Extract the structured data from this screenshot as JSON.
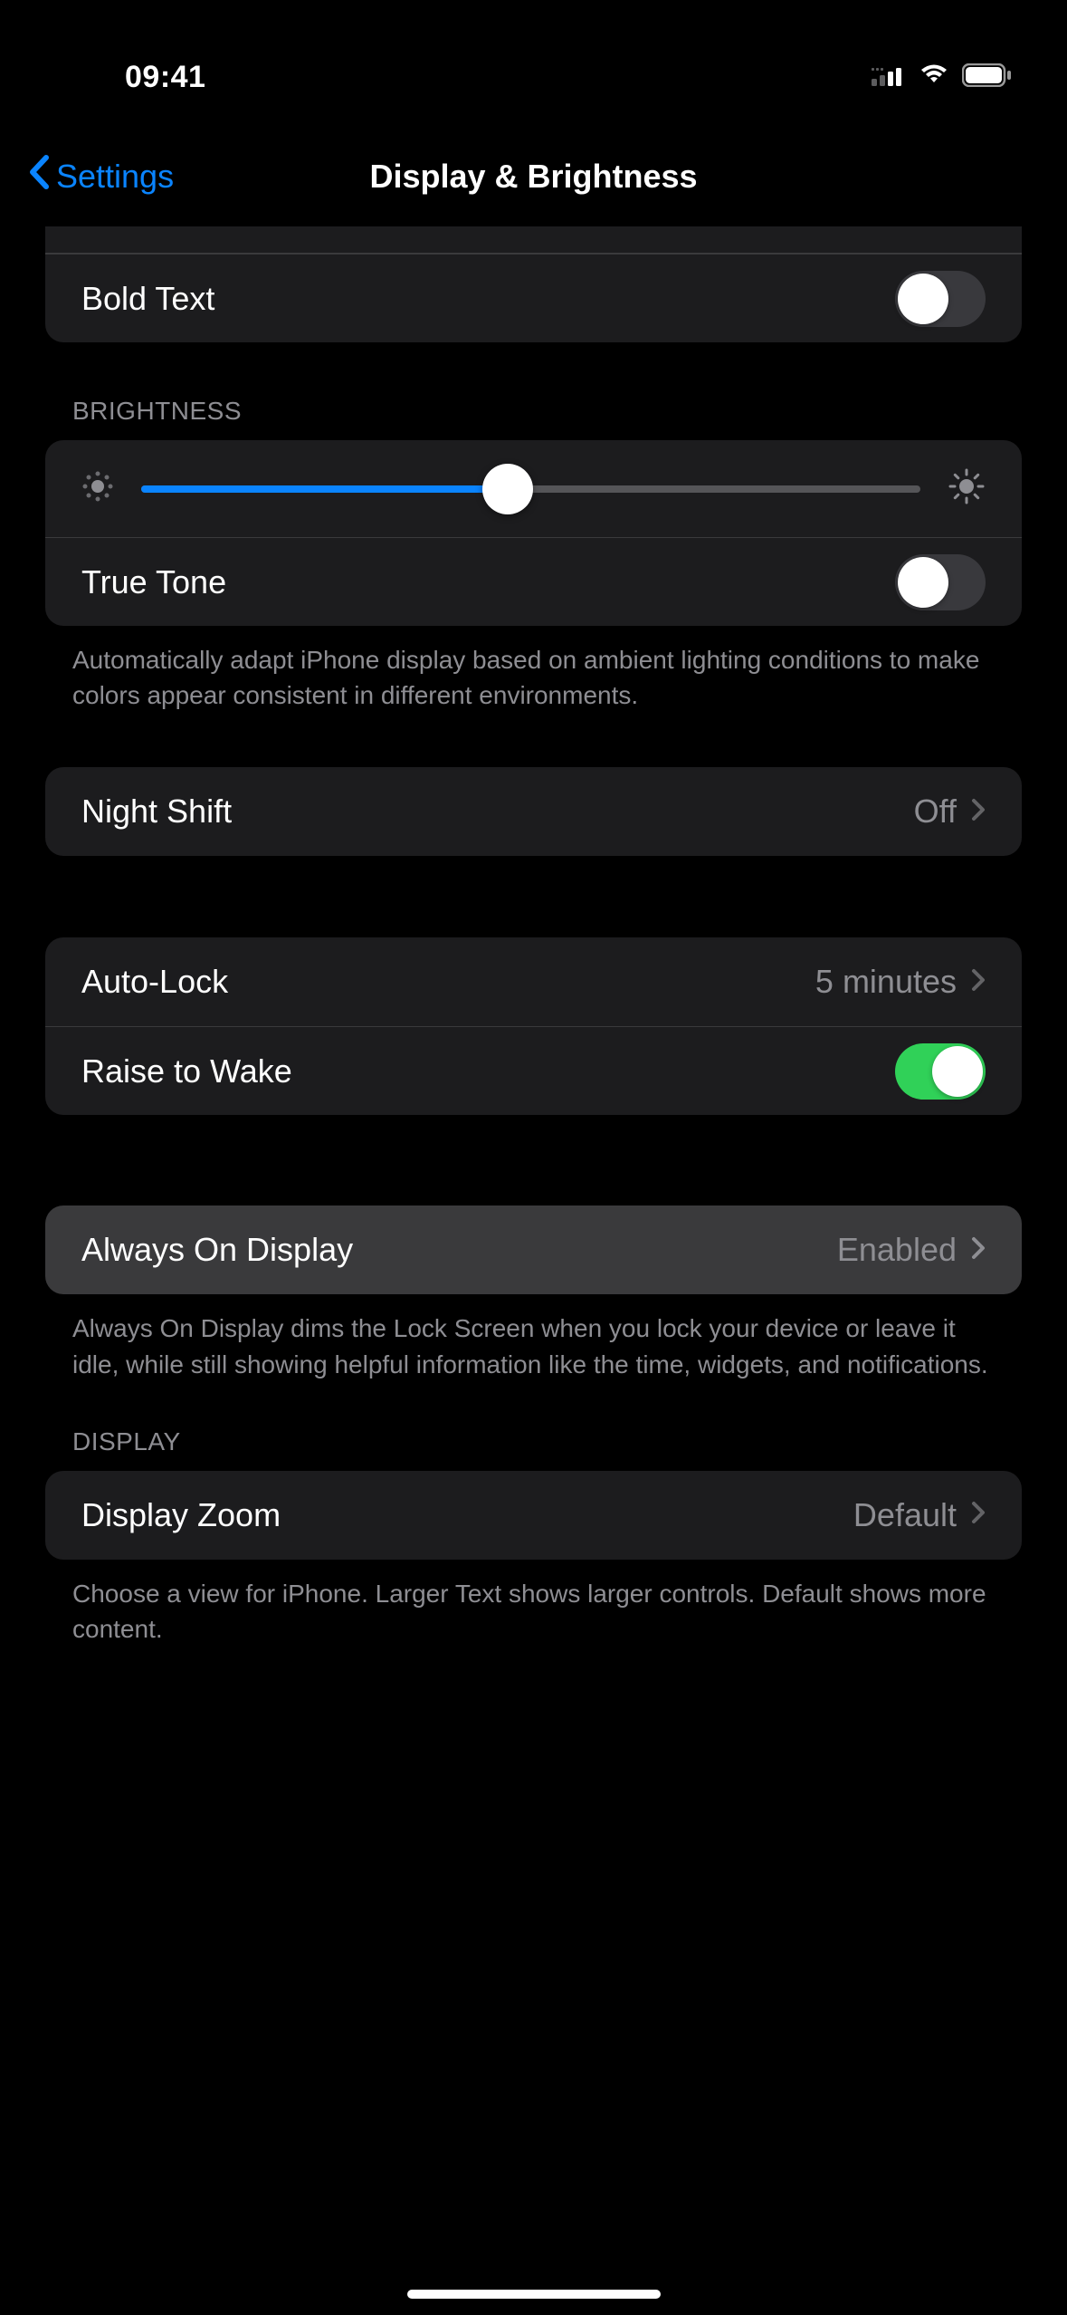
{
  "status": {
    "time": "09:41"
  },
  "nav": {
    "back_label": "Settings",
    "title": "Display & Brightness"
  },
  "sections": {
    "text": {
      "bold_text_label": "Bold Text",
      "bold_text_on": false
    },
    "brightness": {
      "header": "BRIGHTNESS",
      "slider_value": 47,
      "true_tone_label": "True Tone",
      "true_tone_on": false,
      "footer": "Automatically adapt iPhone display based on ambient lighting conditions to make colors appear consistent in different environments."
    },
    "night_shift": {
      "label": "Night Shift",
      "value": "Off"
    },
    "lock": {
      "auto_lock_label": "Auto-Lock",
      "auto_lock_value": "5 minutes",
      "raise_to_wake_label": "Raise to Wake",
      "raise_to_wake_on": true
    },
    "aod": {
      "label": "Always On Display",
      "value": "Enabled",
      "footer": "Always On Display dims the Lock Screen when you lock your device or leave it idle, while still showing helpful information like the time, widgets, and notifications."
    },
    "display": {
      "header": "DISPLAY",
      "zoom_label": "Display Zoom",
      "zoom_value": "Default",
      "footer": "Choose a view for iPhone. Larger Text shows larger controls. Default shows more content."
    }
  }
}
